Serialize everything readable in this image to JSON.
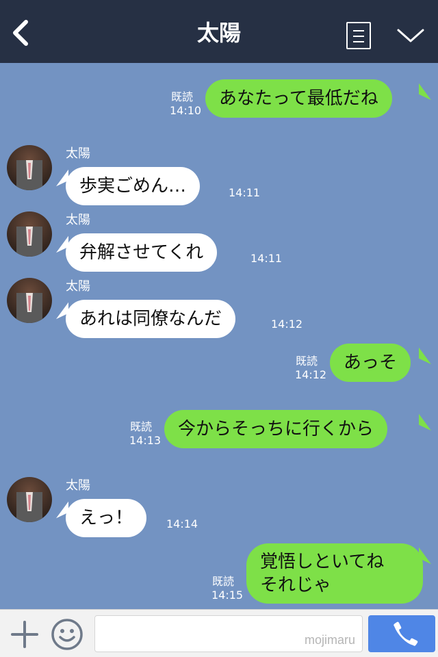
{
  "header": {
    "title": "太陽",
    "back_icon": "chevron-left-icon",
    "menu_icon": "menu-list-icon",
    "collapse_icon": "chevron-down-icon",
    "background": "#263044"
  },
  "chat": {
    "background": "#7393c2",
    "outgoing_color": "#7ee048",
    "incoming_color": "#ffffff",
    "messages": [
      {
        "direction": "out",
        "text": "あなたって最低だね",
        "read": "既読",
        "time": "14:10"
      },
      {
        "direction": "in",
        "sender": "太陽",
        "text": "歩実ごめん…",
        "time": "14:11"
      },
      {
        "direction": "in",
        "sender": "太陽",
        "text": "弁解させてくれ",
        "time": "14:11"
      },
      {
        "direction": "in",
        "sender": "太陽",
        "text": "あれは同僚なんだ",
        "time": "14:12"
      },
      {
        "direction": "out",
        "text": "あっそ",
        "read": "既読",
        "time": "14:12"
      },
      {
        "direction": "out",
        "text": "今からそっちに行くから",
        "read": "既読",
        "time": "14:13"
      },
      {
        "direction": "in",
        "sender": "太陽",
        "text": "えっ！",
        "time": "14:14"
      },
      {
        "direction": "out",
        "text_lines": [
          "覚悟しといてね",
          "それじゃ"
        ],
        "read": "既読",
        "time": "14:15"
      }
    ]
  },
  "footer": {
    "plus_icon": "plus-icon",
    "emoji_icon": "smiley-icon",
    "input_value": "",
    "watermark": "mojimaru",
    "call_icon": "phone-icon",
    "call_color": "#4f86e6"
  }
}
